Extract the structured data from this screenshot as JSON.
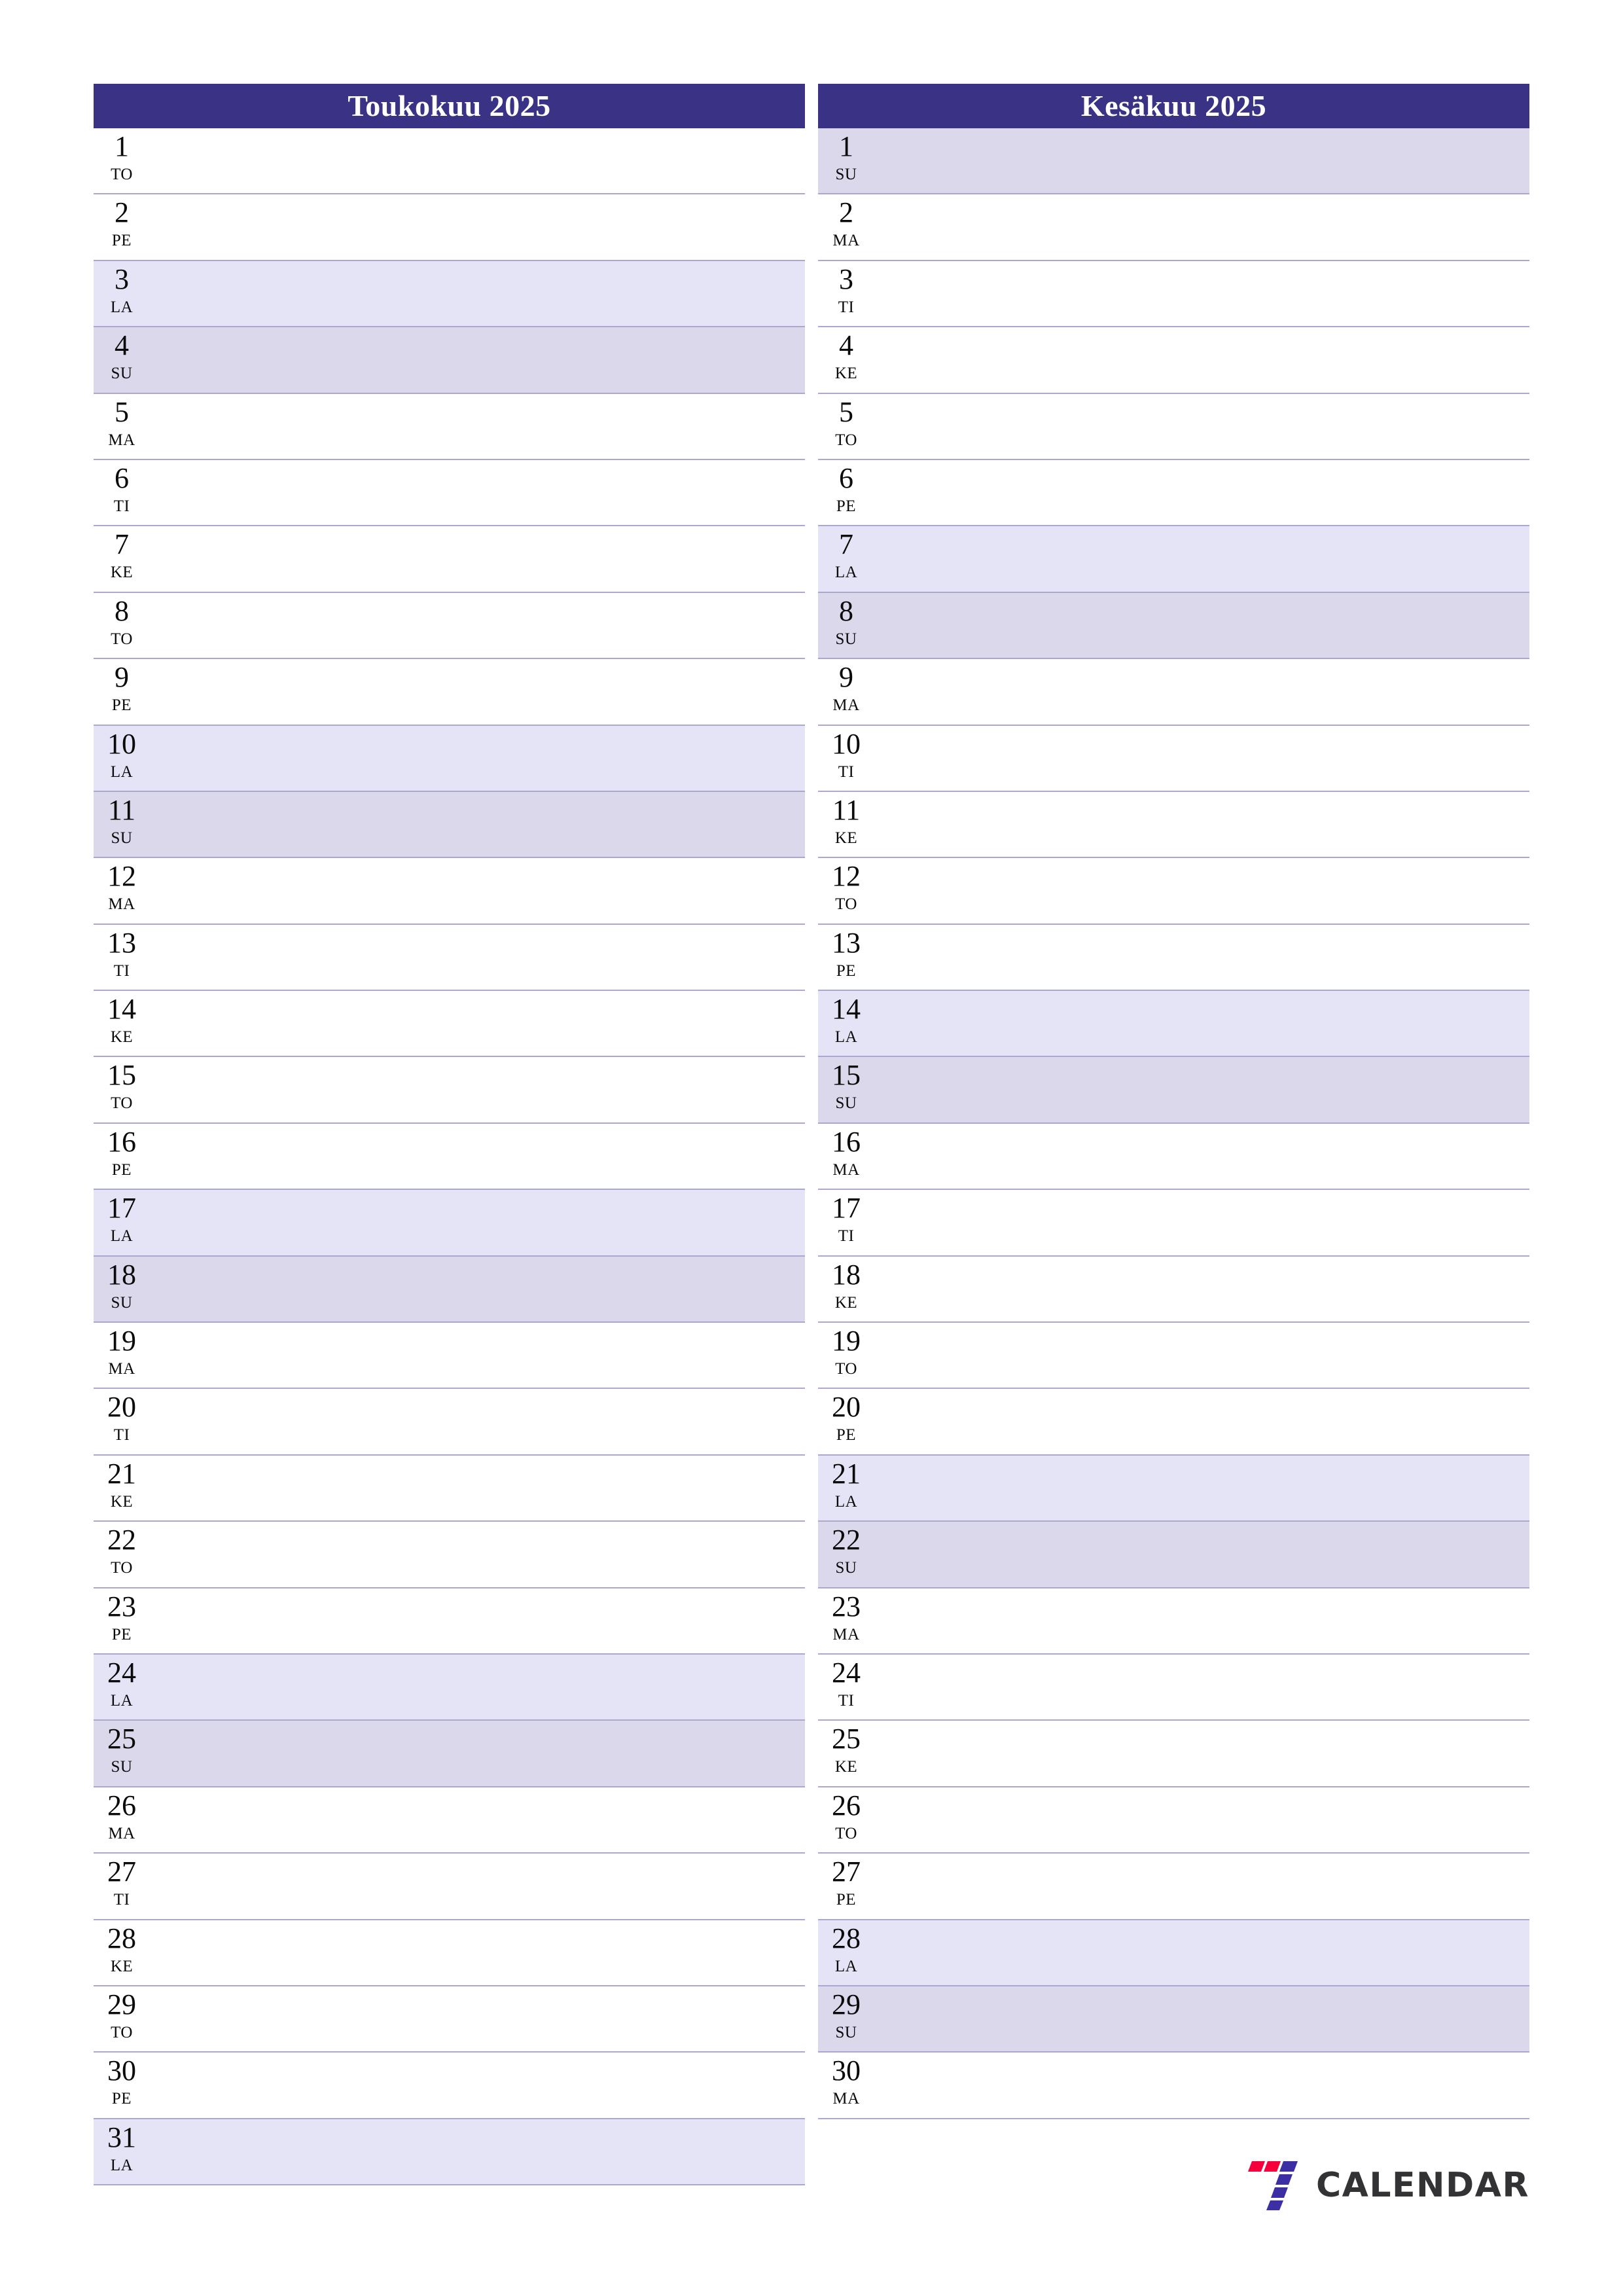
{
  "page": {
    "background": "#ffffff",
    "accent_header": "#393285",
    "saturday_fill": "#e4e4f6",
    "sunday_fill": "#dcd8ec",
    "row_divider": "#aaa8d0"
  },
  "months": [
    {
      "title": "Toukokuu 2025",
      "name": "Toukokuu",
      "year": "2025",
      "days": [
        {
          "num": "1",
          "weekday": "TO"
        },
        {
          "num": "2",
          "weekday": "PE"
        },
        {
          "num": "3",
          "weekday": "LA"
        },
        {
          "num": "4",
          "weekday": "SU"
        },
        {
          "num": "5",
          "weekday": "MA"
        },
        {
          "num": "6",
          "weekday": "TI"
        },
        {
          "num": "7",
          "weekday": "KE"
        },
        {
          "num": "8",
          "weekday": "TO"
        },
        {
          "num": "9",
          "weekday": "PE"
        },
        {
          "num": "10",
          "weekday": "LA"
        },
        {
          "num": "11",
          "weekday": "SU"
        },
        {
          "num": "12",
          "weekday": "MA"
        },
        {
          "num": "13",
          "weekday": "TI"
        },
        {
          "num": "14",
          "weekday": "KE"
        },
        {
          "num": "15",
          "weekday": "TO"
        },
        {
          "num": "16",
          "weekday": "PE"
        },
        {
          "num": "17",
          "weekday": "LA"
        },
        {
          "num": "18",
          "weekday": "SU"
        },
        {
          "num": "19",
          "weekday": "MA"
        },
        {
          "num": "20",
          "weekday": "TI"
        },
        {
          "num": "21",
          "weekday": "KE"
        },
        {
          "num": "22",
          "weekday": "TO"
        },
        {
          "num": "23",
          "weekday": "PE"
        },
        {
          "num": "24",
          "weekday": "LA"
        },
        {
          "num": "25",
          "weekday": "SU"
        },
        {
          "num": "26",
          "weekday": "MA"
        },
        {
          "num": "27",
          "weekday": "TI"
        },
        {
          "num": "28",
          "weekday": "KE"
        },
        {
          "num": "29",
          "weekday": "TO"
        },
        {
          "num": "30",
          "weekday": "PE"
        },
        {
          "num": "31",
          "weekday": "LA"
        }
      ]
    },
    {
      "title": "Kesäkuu 2025",
      "name": "Kesäkuu",
      "year": "2025",
      "days": [
        {
          "num": "1",
          "weekday": "SU"
        },
        {
          "num": "2",
          "weekday": "MA"
        },
        {
          "num": "3",
          "weekday": "TI"
        },
        {
          "num": "4",
          "weekday": "KE"
        },
        {
          "num": "5",
          "weekday": "TO"
        },
        {
          "num": "6",
          "weekday": "PE"
        },
        {
          "num": "7",
          "weekday": "LA"
        },
        {
          "num": "8",
          "weekday": "SU"
        },
        {
          "num": "9",
          "weekday": "MA"
        },
        {
          "num": "10",
          "weekday": "TI"
        },
        {
          "num": "11",
          "weekday": "KE"
        },
        {
          "num": "12",
          "weekday": "TO"
        },
        {
          "num": "13",
          "weekday": "PE"
        },
        {
          "num": "14",
          "weekday": "LA"
        },
        {
          "num": "15",
          "weekday": "SU"
        },
        {
          "num": "16",
          "weekday": "MA"
        },
        {
          "num": "17",
          "weekday": "TI"
        },
        {
          "num": "18",
          "weekday": "KE"
        },
        {
          "num": "19",
          "weekday": "TO"
        },
        {
          "num": "20",
          "weekday": "PE"
        },
        {
          "num": "21",
          "weekday": "LA"
        },
        {
          "num": "22",
          "weekday": "SU"
        },
        {
          "num": "23",
          "weekday": "MA"
        },
        {
          "num": "24",
          "weekday": "TI"
        },
        {
          "num": "25",
          "weekday": "KE"
        },
        {
          "num": "26",
          "weekday": "TO"
        },
        {
          "num": "27",
          "weekday": "PE"
        },
        {
          "num": "28",
          "weekday": "LA"
        },
        {
          "num": "29",
          "weekday": "SU"
        },
        {
          "num": "30",
          "weekday": "MA"
        }
      ]
    }
  ],
  "footer": {
    "logo_icon": "seven-mark-icon",
    "logo_text": "CALENDAR",
    "logo_red": "#f5003c",
    "logo_purple": "#3b2fa3",
    "logo_text_color": "#333336"
  }
}
